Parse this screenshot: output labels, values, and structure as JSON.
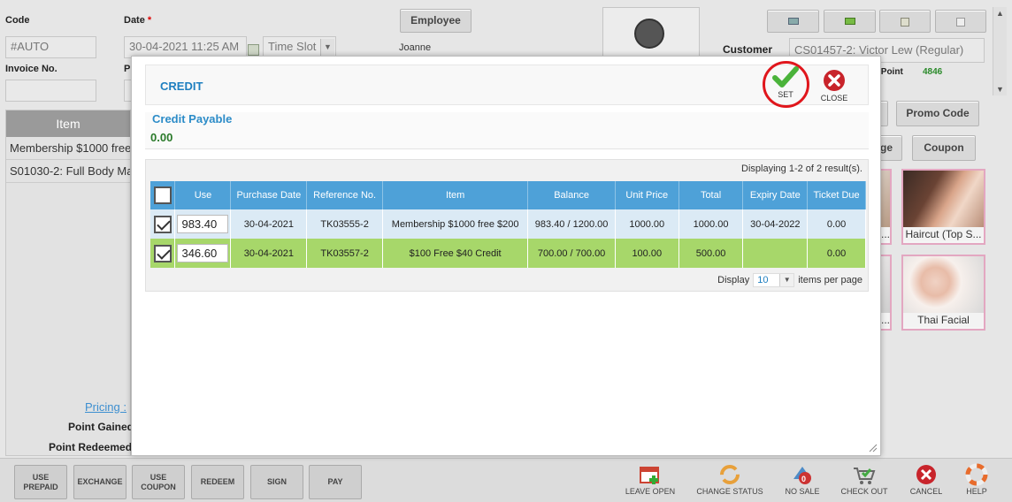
{
  "header": {
    "code_label": "Code",
    "code_value": "#AUTO",
    "date_label": "Date",
    "date_required": "*",
    "date_value": "30-04-2021 11:25 AM",
    "timeslot_placeholder": "Time Slot",
    "invoice_label": "Invoice No.",
    "p_label": "P",
    "employee_button": "Employee",
    "employee_name": "Joanne",
    "customer_label": "Customer",
    "customer_value": "CS01457-2: Victor Lew (Regular)",
    "card_point_label": "rd Point",
    "card_point_value": "4846"
  },
  "left_panel": {
    "header": "Item",
    "rows": [
      "Membership $1000 free",
      "S01030-2: Full Body Ma"
    ],
    "pricing_link": "Pricing :",
    "point_gained_label": "Point Gained",
    "point_redeemed_label": "Point Redeemed"
  },
  "right_panel": {
    "promo_code_button": "Promo Code",
    "package_button_partial": "ge",
    "coupon_button": "Coupon",
    "tiles": [
      {
        "label": "Haircut (Top S..."
      },
      {
        "label": "Thai Facial"
      }
    ],
    "partial_tile_labels": [
      "...",
      "..."
    ]
  },
  "modal": {
    "title": "CREDIT",
    "set_label": "SET",
    "close_label": "CLOSE",
    "payable_title": "Credit Payable",
    "payable_value": "0.00",
    "displaying": "Displaying 1-2 of 2 result(s).",
    "columns": [
      "Use",
      "Purchase Date",
      "Reference No.",
      "Item",
      "Balance",
      "Unit Price",
      "Total",
      "Expiry Date",
      "Ticket Due"
    ],
    "rows": [
      {
        "checked": true,
        "use": "983.40",
        "purchase_date": "30-04-2021",
        "reference": "TK03555-2",
        "item": "Membership $1000 free $200",
        "balance": "983.40 / 1200.00",
        "unit_price": "1000.00",
        "total": "1000.00",
        "expiry_date": "30-04-2022",
        "ticket_due": "0.00"
      },
      {
        "checked": true,
        "use": "346.60",
        "purchase_date": "30-04-2021",
        "reference": "TK03557-2",
        "item": "$100 Free $40 Credit",
        "balance": "700.00 / 700.00",
        "unit_price": "100.00",
        "total": "500.00",
        "expiry_date": "",
        "ticket_due": "0.00"
      }
    ],
    "pager_display_label": "Display",
    "pager_value": "10",
    "pager_suffix": "items per page"
  },
  "bottom_bar": {
    "buttons": [
      "USE PREPAID",
      "EXCHANGE",
      "USE COUPON",
      "REDEEM",
      "SIGN",
      "PAY"
    ],
    "icon_buttons": [
      "LEAVE OPEN",
      "CHANGE STATUS",
      "NO SALE",
      "CHECK OUT",
      "CANCEL",
      "HELP"
    ]
  },
  "colors": {
    "accent_blue": "#4ea1d8",
    "row_selected_green": "#a7d76a",
    "row_alt_blue": "#dbeaf5",
    "set_highlight_red": "#e0161c"
  }
}
